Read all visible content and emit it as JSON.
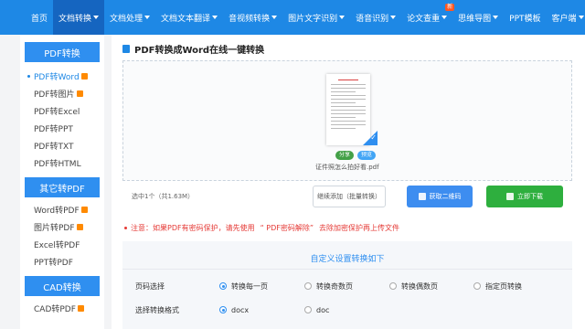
{
  "nav": {
    "items": [
      {
        "label": "首页",
        "active": false,
        "caret": false
      },
      {
        "label": "文档转换",
        "active": true,
        "caret": true
      },
      {
        "label": "文档处理",
        "active": false,
        "caret": true
      },
      {
        "label": "文档文本翻译",
        "active": false,
        "caret": true
      },
      {
        "label": "音视频转换",
        "active": false,
        "caret": true
      },
      {
        "label": "图片文字识别",
        "active": false,
        "caret": true
      },
      {
        "label": "语音识别",
        "active": false,
        "caret": true
      },
      {
        "label": "论文查重",
        "active": false,
        "caret": true
      },
      {
        "label": "思维导图",
        "active": false,
        "caret": true
      },
      {
        "label": "PPT模板",
        "active": false,
        "caret": false
      },
      {
        "label": "客户端",
        "active": false,
        "caret": true
      }
    ],
    "badge_label": "新"
  },
  "sidebar": {
    "groups": [
      {
        "title": "PDF转换",
        "items": [
          {
            "label": "PDF转Word",
            "active": true,
            "hot": true
          },
          {
            "label": "PDF转图片",
            "active": false,
            "hot": true
          },
          {
            "label": "PDF转Excel",
            "active": false,
            "hot": false
          },
          {
            "label": "PDF转PPT",
            "active": false,
            "hot": false
          },
          {
            "label": "PDF转TXT",
            "active": false,
            "hot": false
          },
          {
            "label": "PDF转HTML",
            "active": false,
            "hot": false
          }
        ]
      },
      {
        "title": "其它转PDF",
        "items": [
          {
            "label": "Word转PDF",
            "active": false,
            "hot": true
          },
          {
            "label": "图片转PDF",
            "active": false,
            "hot": true
          },
          {
            "label": "Excel转PDF",
            "active": false,
            "hot": false
          },
          {
            "label": "PPT转PDF",
            "active": false,
            "hot": false
          }
        ]
      },
      {
        "title": "CAD转换",
        "items": [
          {
            "label": "CAD转PDF",
            "active": false,
            "hot": true
          }
        ]
      }
    ]
  },
  "main": {
    "title": "PDF转换成Word在线一键转换",
    "file": {
      "name": "证件照怎么拍好看.pdf",
      "share_label": "分享",
      "preview_label": "预览"
    },
    "selection_info": "选中1个（共1.63M）",
    "buttons": {
      "add": "继续添加（批量转换）",
      "qr": "获取二维码",
      "download": "立即下载"
    },
    "notice": {
      "prefix": "注意：如果PDF有密码保护，请先使用",
      "link": "“ PDF密码解除”",
      "suffix": "去除加密保护再上传文件"
    },
    "settings": {
      "title": "自定义设置转换如下",
      "page_label": "页码选择",
      "page_options": [
        {
          "label": "转换每一页",
          "selected": true
        },
        {
          "label": "转换奇数页",
          "selected": false
        },
        {
          "label": "转换偶数页",
          "selected": false
        },
        {
          "label": "指定页转换",
          "selected": false
        }
      ],
      "format_label": "选择转换格式",
      "format_options": [
        {
          "label": "docx",
          "selected": true
        },
        {
          "label": "doc",
          "selected": false
        }
      ]
    }
  },
  "colors": {
    "primary": "#1e88e5",
    "download": "#2eaf3e",
    "notice": "#e53935"
  }
}
